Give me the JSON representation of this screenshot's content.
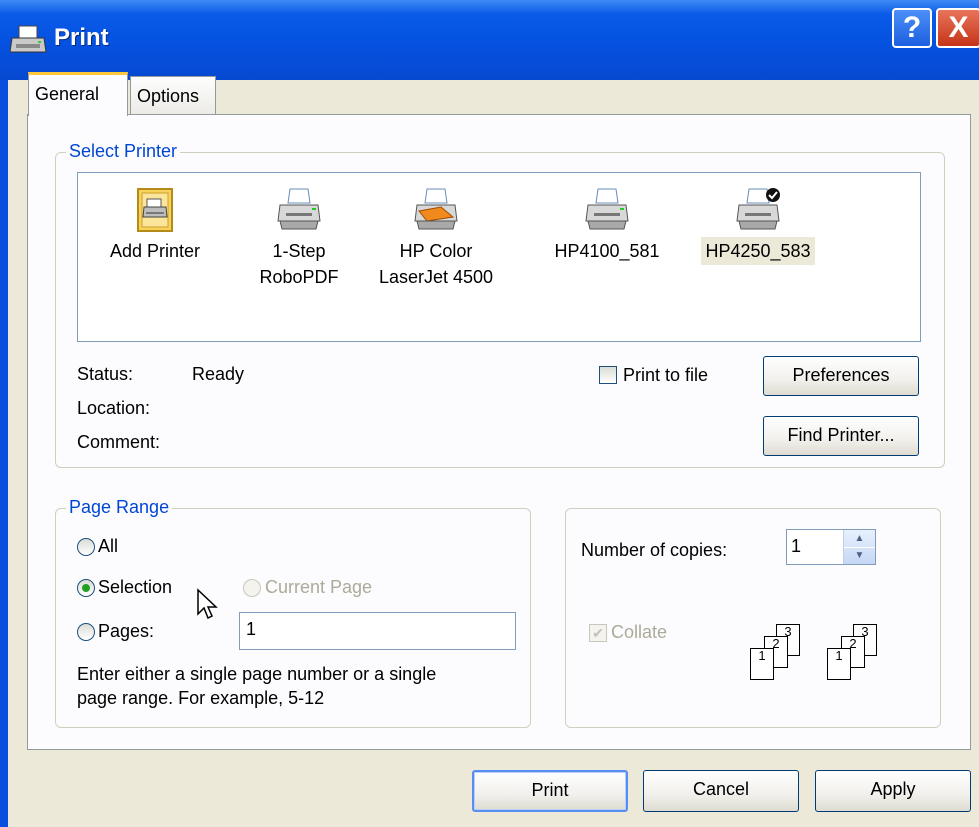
{
  "window": {
    "title": "Print",
    "help_glyph": "?",
    "close_glyph": "X",
    "colors": {
      "titlebar": "#0551e0",
      "face": "#ece9d8",
      "group_label": "#0046d5"
    }
  },
  "tabs": [
    {
      "label": "General",
      "active": true
    },
    {
      "label": "Options",
      "active": false
    }
  ],
  "select_printer": {
    "legend": "Select Printer",
    "printers": [
      {
        "line1": "Add Printer",
        "line2": "",
        "icon": "add-printer-icon",
        "selected": false
      },
      {
        "line1": "1-Step",
        "line2": "RoboPDF",
        "icon": "printer-icon",
        "selected": false
      },
      {
        "line1": "HP Color",
        "line2": "LaserJet 4500",
        "icon": "color-printer-icon",
        "selected": false
      },
      {
        "line1": "HP4100_581",
        "line2": "",
        "icon": "printer-icon",
        "selected": false
      },
      {
        "line1": "HP4250_583",
        "line2": "",
        "icon": "default-printer-icon",
        "selected": true
      }
    ],
    "status_label": "Status:",
    "status_value": "Ready",
    "location_label": "Location:",
    "location_value": "",
    "comment_label": "Comment:",
    "comment_value": "",
    "print_to_file_label": "Print to file",
    "print_to_file_checked": false,
    "preferences_button": "Preferences",
    "find_printer_button": "Find Printer..."
  },
  "page_range": {
    "legend": "Page Range",
    "all_label": "All",
    "selection_label": "Selection",
    "current_page_label": "Current Page",
    "pages_label": "Pages:",
    "pages_value": "1",
    "selected_option": "Selection",
    "help_line1": "Enter either a single page number or a single",
    "help_line2": "page range.  For example, 5-12"
  },
  "copies": {
    "number_label": "Number of copies:",
    "number_value": "1",
    "collate_label": "Collate",
    "collate_checked": true,
    "collate_enabled": false,
    "collate_pages": [
      "1",
      "2",
      "3"
    ]
  },
  "footer": {
    "print_button": "Print",
    "cancel_button": "Cancel",
    "apply_button": "Apply"
  }
}
